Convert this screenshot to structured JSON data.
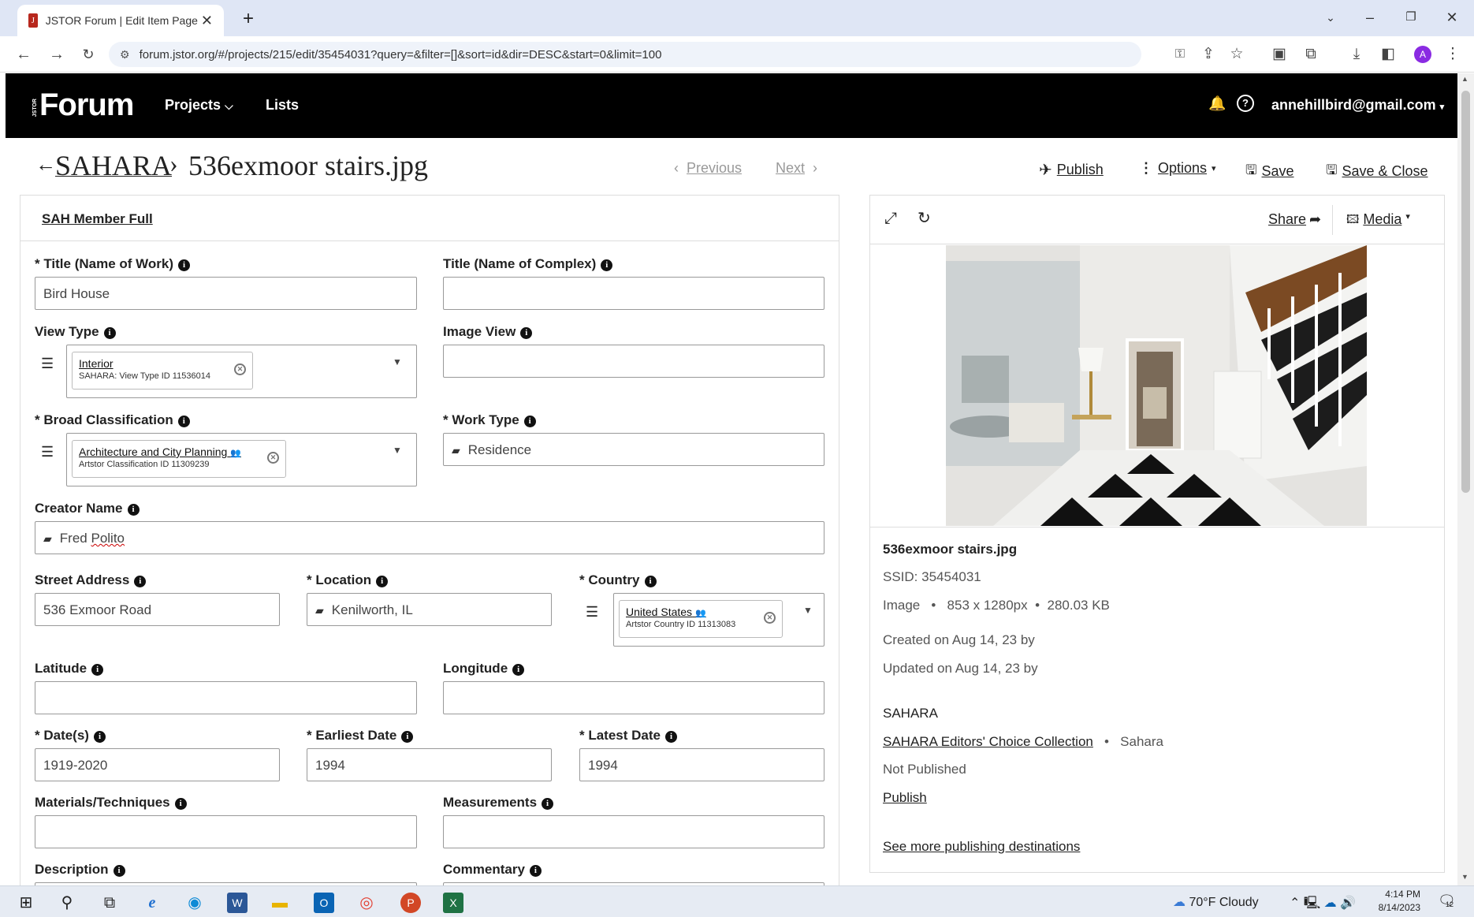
{
  "browser": {
    "tab_title": "JSTOR Forum | Edit Item Page",
    "url": "forum.jstor.org/#/projects/215/edit/35454031?query=&filter=[]&sort=id&dir=DESC&start=0&limit=100"
  },
  "nav": {
    "logo": "Forum",
    "logo_small": "JSTOR",
    "projects": "Projects",
    "lists": "Lists",
    "user": "annehillbird@gmail.com"
  },
  "header": {
    "breadcrumb_project": "SAHARA",
    "breadcrumb_sep": "›",
    "file_name": "536exmoor stairs.jpg",
    "previous": "Previous",
    "next": "Next",
    "publish": "Publish",
    "options": "Options",
    "save": "Save",
    "save_close": "Save & Close"
  },
  "form": {
    "title": "SAH Member Full",
    "fields": {
      "title_name_of_work": {
        "label": "* Title (Name of Work)",
        "value": "Bird House"
      },
      "title_name_of_complex": {
        "label": "Title (Name of Complex)",
        "value": ""
      },
      "view_type": {
        "label": "View Type",
        "chip_title": "Interior",
        "chip_sub": "SAHARA: View Type ID 11536014"
      },
      "image_view": {
        "label": "Image View",
        "value": ""
      },
      "broad_classification": {
        "label": "* Broad Classification",
        "chip_title": "Architecture and City Planning",
        "chip_sub": "Artstor Classification ID 11309239"
      },
      "work_type": {
        "label": "* Work Type",
        "value": "Residence"
      },
      "creator_name": {
        "label": "Creator Name",
        "value_first": "Fred",
        "value_last": "Polito"
      },
      "street_address": {
        "label": "Street Address",
        "value": "536 Exmoor Road"
      },
      "location": {
        "label": "* Location",
        "value": "Kenilworth, IL"
      },
      "country": {
        "label": "* Country",
        "chip_title": "United States",
        "chip_sub": "Artstor Country ID 11313083"
      },
      "latitude": {
        "label": "Latitude",
        "value": ""
      },
      "longitude": {
        "label": "Longitude",
        "value": ""
      },
      "dates": {
        "label": "* Date(s)",
        "value": "1919-2020"
      },
      "earliest_date": {
        "label": "* Earliest Date",
        "value": "1994"
      },
      "latest_date": {
        "label": "* Latest Date",
        "value": "1994"
      },
      "materials": {
        "label": "Materials/Techniques",
        "value": ""
      },
      "measurements": {
        "label": "Measurements",
        "value": ""
      },
      "description": {
        "label": "Description"
      },
      "commentary": {
        "label": "Commentary"
      }
    }
  },
  "media": {
    "share": "Share",
    "media": "Media",
    "file_name": "536exmoor stairs.jpg",
    "ssid": "SSID: 35454031",
    "type": "Image",
    "dimensions": "853 x 1280px",
    "size": "280.03 KB",
    "created": "Created on Aug 14, 23 by",
    "updated": "Updated on Aug 14, 23 by",
    "project": "SAHARA",
    "collection": "SAHARA Editors' Choice Collection",
    "collection_short": "Sahara",
    "publish_status": "Not Published",
    "publish_link": "Publish",
    "more_destinations": "See more publishing destinations"
  },
  "taskbar": {
    "weather": "70°F  Cloudy",
    "time": "4:14 PM",
    "date": "8/14/2023",
    "notif_count": "12"
  }
}
